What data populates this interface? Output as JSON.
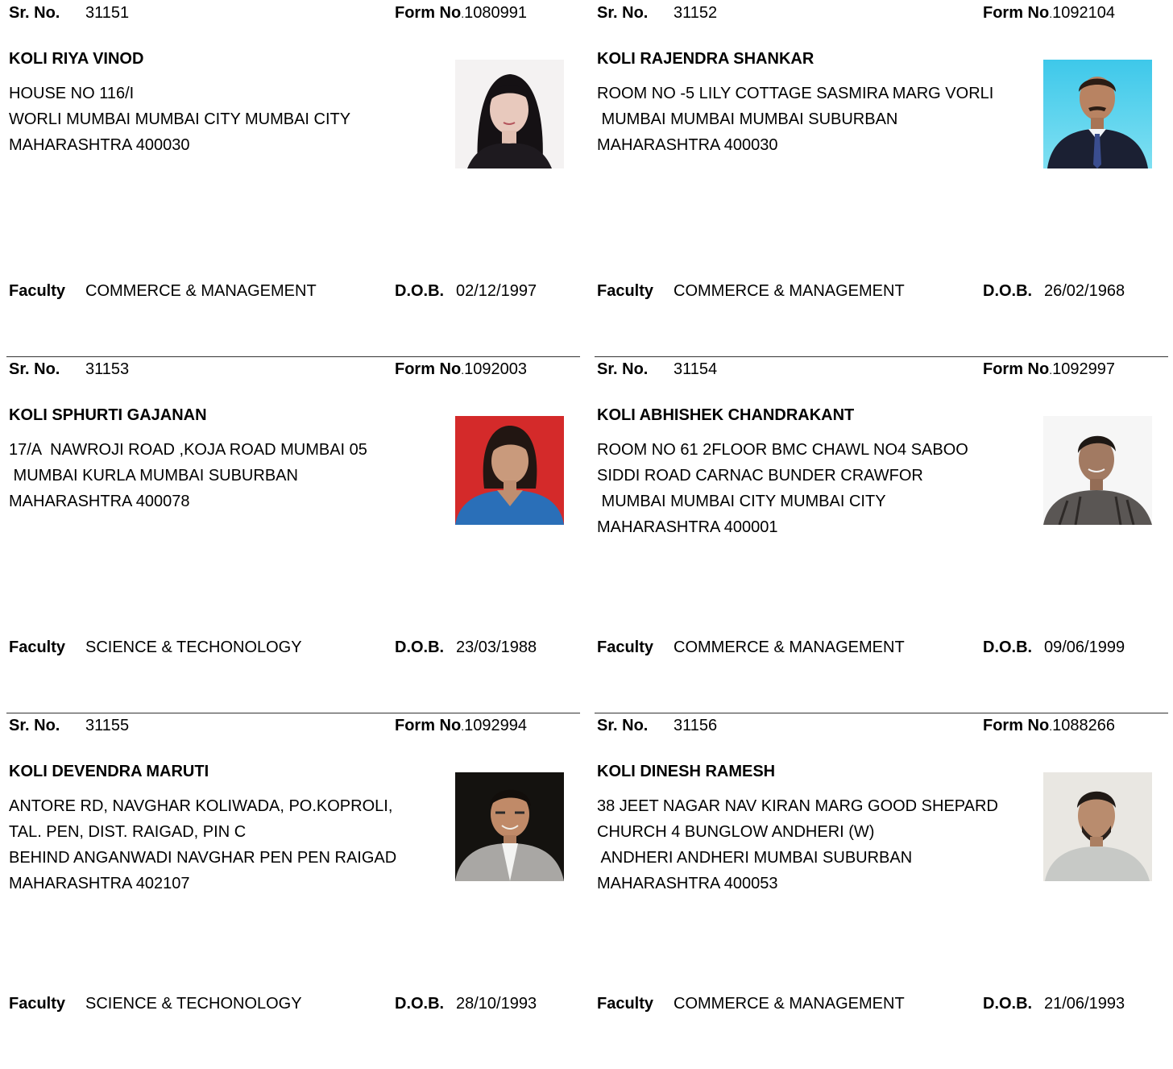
{
  "labels": {
    "sr": "Sr. No.",
    "form": "Form No",
    "faculty": "Faculty",
    "dob": "D.O.B."
  },
  "cards": [
    {
      "sr": "31151",
      "form": "1080991",
      "name": "KOLI RIYA VINOD",
      "address": "HOUSE NO 116/I\nWORLI MUMBAI MUMBAI CITY MUMBAI CITY\nMAHARASHTRA 400030",
      "faculty": "COMMERCE & MANAGEMENT",
      "dob": "02/12/1997"
    },
    {
      "sr": "31152",
      "form": "1092104",
      "name": "KOLI RAJENDRA SHANKAR",
      "address": "ROOM NO -5 LILY COTTAGE SASMIRA MARG VORLI\n MUMBAI MUMBAI MUMBAI SUBURBAN\nMAHARASHTRA 400030",
      "faculty": "COMMERCE & MANAGEMENT",
      "dob": "26/02/1968"
    },
    {
      "sr": "31153",
      "form": "1092003",
      "name": "KOLI SPHURTI GAJANAN",
      "address": "17/A  NAWROJI ROAD ,KOJA ROAD MUMBAI 05\n MUMBAI KURLA MUMBAI SUBURBAN\nMAHARASHTRA 400078",
      "faculty": "SCIENCE & TECHONOLOGY",
      "dob": "23/03/1988"
    },
    {
      "sr": "31154",
      "form": "1092997",
      "name": "KOLI ABHISHEK CHANDRAKANT",
      "address": "ROOM NO 61 2FLOOR BMC CHAWL NO4 SABOO\nSIDDI ROAD CARNAC BUNDER CRAWFOR\n MUMBAI MUMBAI CITY MUMBAI CITY\nMAHARASHTRA 400001",
      "faculty": "COMMERCE & MANAGEMENT",
      "dob": "09/06/1999"
    },
    {
      "sr": "31155",
      "form": "1092994",
      "name": "KOLI DEVENDRA MARUTI",
      "address": "ANTORE RD, NAVGHAR KOLIWADA, PO.KOPROLI,\nTAL. PEN, DIST. RAIGAD, PIN C\nBEHIND ANGANWADI NAVGHAR PEN PEN RAIGAD\nMAHARASHTRA 402107",
      "faculty": "SCIENCE & TECHONOLOGY",
      "dob": "28/10/1993"
    },
    {
      "sr": "31156",
      "form": "1088266",
      "name": "KOLI DINESH RAMESH",
      "address": "38 JEET NAGAR NAV KIRAN MARG GOOD SHEPARD\nCHURCH 4 BUNGLOW ANDHERI (W)\n ANDHERI ANDHERI MUMBAI SUBURBAN\nMAHARASHTRA 400053",
      "faculty": "COMMERCE & MANAGEMENT",
      "dob": "21/06/1993"
    }
  ]
}
